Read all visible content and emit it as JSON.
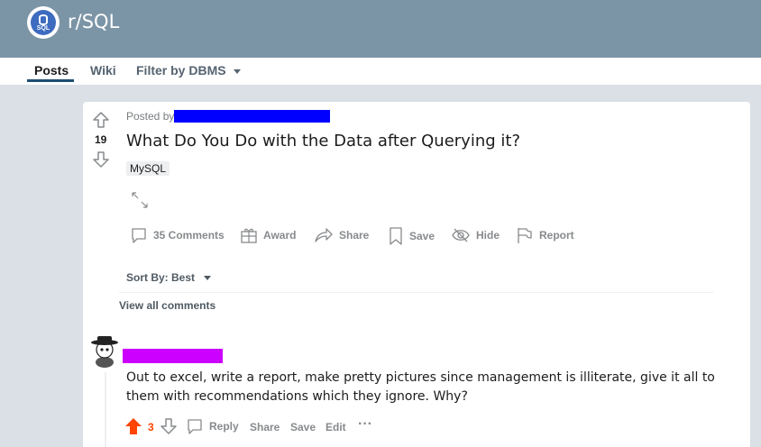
{
  "subreddit": {
    "name": "r/SQL",
    "icon_label": "SQL"
  },
  "nav": {
    "posts": "Posts",
    "wiki": "Wiki",
    "filter": "Filter by DBMS"
  },
  "post": {
    "votes": "19",
    "posted_by": "Posted by",
    "title": "What Do You Do with the Data after Querying it?",
    "flair": "MySQL",
    "actions": {
      "comments": "35 Comments",
      "award": "Award",
      "share": "Share",
      "save": "Save",
      "hide": "Hide",
      "report": "Report"
    }
  },
  "comments_section": {
    "sort_label": "Sort By: Best",
    "view_all": "View all comments"
  },
  "comment": {
    "text": "Out to excel, write a report, make pretty pictures since management is illiterate, give it all to them with recommendations which they ignore. Why?",
    "votes": "3",
    "actions": {
      "reply": "Reply",
      "share": "Share",
      "save": "Save",
      "edit": "Edit",
      "more": "···"
    }
  },
  "colors": {
    "banner": "#7c95a6",
    "upvote_active": "#ff4500",
    "redaction_user": "#0000ff",
    "redaction_commenter": "#cc00ff"
  },
  "icons": [
    "sql-subreddit-icon",
    "upvote-icon",
    "downvote-icon",
    "expand-icon",
    "comment-icon",
    "award-icon",
    "share-icon",
    "save-icon",
    "hide-icon",
    "report-icon",
    "caret-down-icon",
    "avatar"
  ]
}
